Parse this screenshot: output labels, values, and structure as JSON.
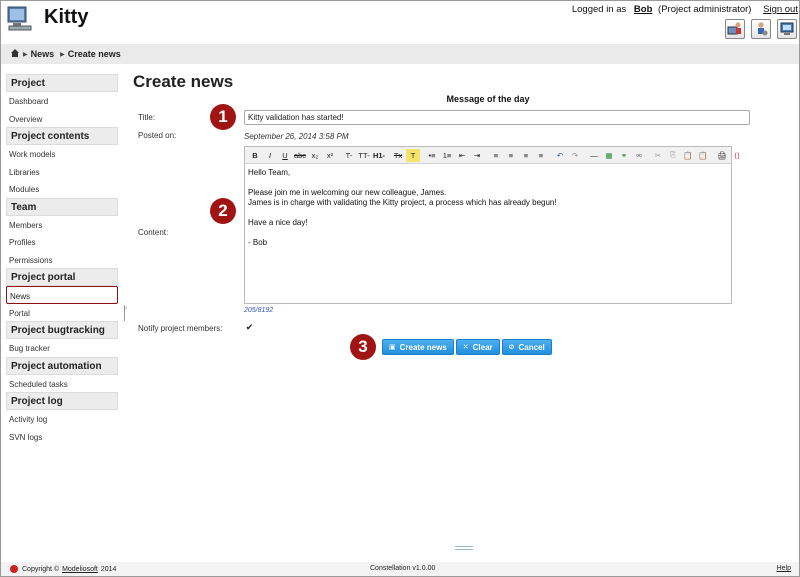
{
  "app": {
    "title": "Kitty"
  },
  "user": {
    "logged_in_as": "Logged in as",
    "name": "Bob",
    "role": "(Project administrator)",
    "signout": "Sign out"
  },
  "breadcrumb": {
    "items": [
      "News",
      "Create news"
    ]
  },
  "sidebar": {
    "sections": [
      {
        "title": "Project",
        "items": [
          "Dashboard",
          "Overview"
        ]
      },
      {
        "title": "Project contents",
        "items": [
          "Work models",
          "Libraries",
          "Modules"
        ]
      },
      {
        "title": "Team",
        "items": [
          "Members",
          "Profiles",
          "Permissions"
        ]
      },
      {
        "title": "Project portal",
        "items": [
          "News",
          "Portal"
        ]
      },
      {
        "title": "Project bugtracking",
        "items": [
          "Bug tracker"
        ]
      },
      {
        "title": "Project automation",
        "items": [
          "Scheduled tasks"
        ]
      },
      {
        "title": "Project log",
        "items": [
          "Activity log",
          "SVN logs"
        ]
      }
    ],
    "active_item": "News"
  },
  "main": {
    "page_title": "Create news",
    "section_title": "Message of the day",
    "title_label": "Title:",
    "title_value": "Kitty validation has started!",
    "posted_label": "Posted on:",
    "posted_value": "September 26, 2014 3:58 PM",
    "content_label": "Content:",
    "content_lines": [
      "Hello Team,",
      "",
      "Please join me in welcoming our new colleague, James.",
      "James is in charge with validating the Kitty project, a process which has already begun!",
      "",
      "Have a nice day!",
      "",
      "- Bob"
    ],
    "char_counter": "205/8192",
    "notify_label": "Notify project members:",
    "notify_checked": true,
    "buttons": {
      "create": "Create news",
      "clear": "Clear",
      "cancel": "Cancel"
    },
    "callouts": [
      "1",
      "2",
      "3"
    ]
  },
  "toolbar": {
    "buttons": [
      "B",
      "I",
      "U",
      "abc",
      "x₂",
      "x²",
      "T-",
      "TT-",
      "H1-",
      "Tx",
      "T",
      "•≡",
      "1≡",
      "⇤",
      "⇥",
      "≡",
      "≡",
      "≡",
      "≡",
      "↶",
      "↷",
      "—",
      "▦",
      "⚭",
      "⚮",
      "✂",
      "⎘",
      "📋",
      "📋",
      "🖨",
      "⟨⟩"
    ]
  },
  "footer": {
    "copyright_prefix": "Copyright ©",
    "company": "Modeliosoft",
    "year": "2014",
    "version": "Constellation v1.0.00",
    "help": "Help"
  },
  "colors": {
    "accent_button": "#1f8fdd",
    "callout": "#a11414",
    "active_border": "#8b1010"
  }
}
